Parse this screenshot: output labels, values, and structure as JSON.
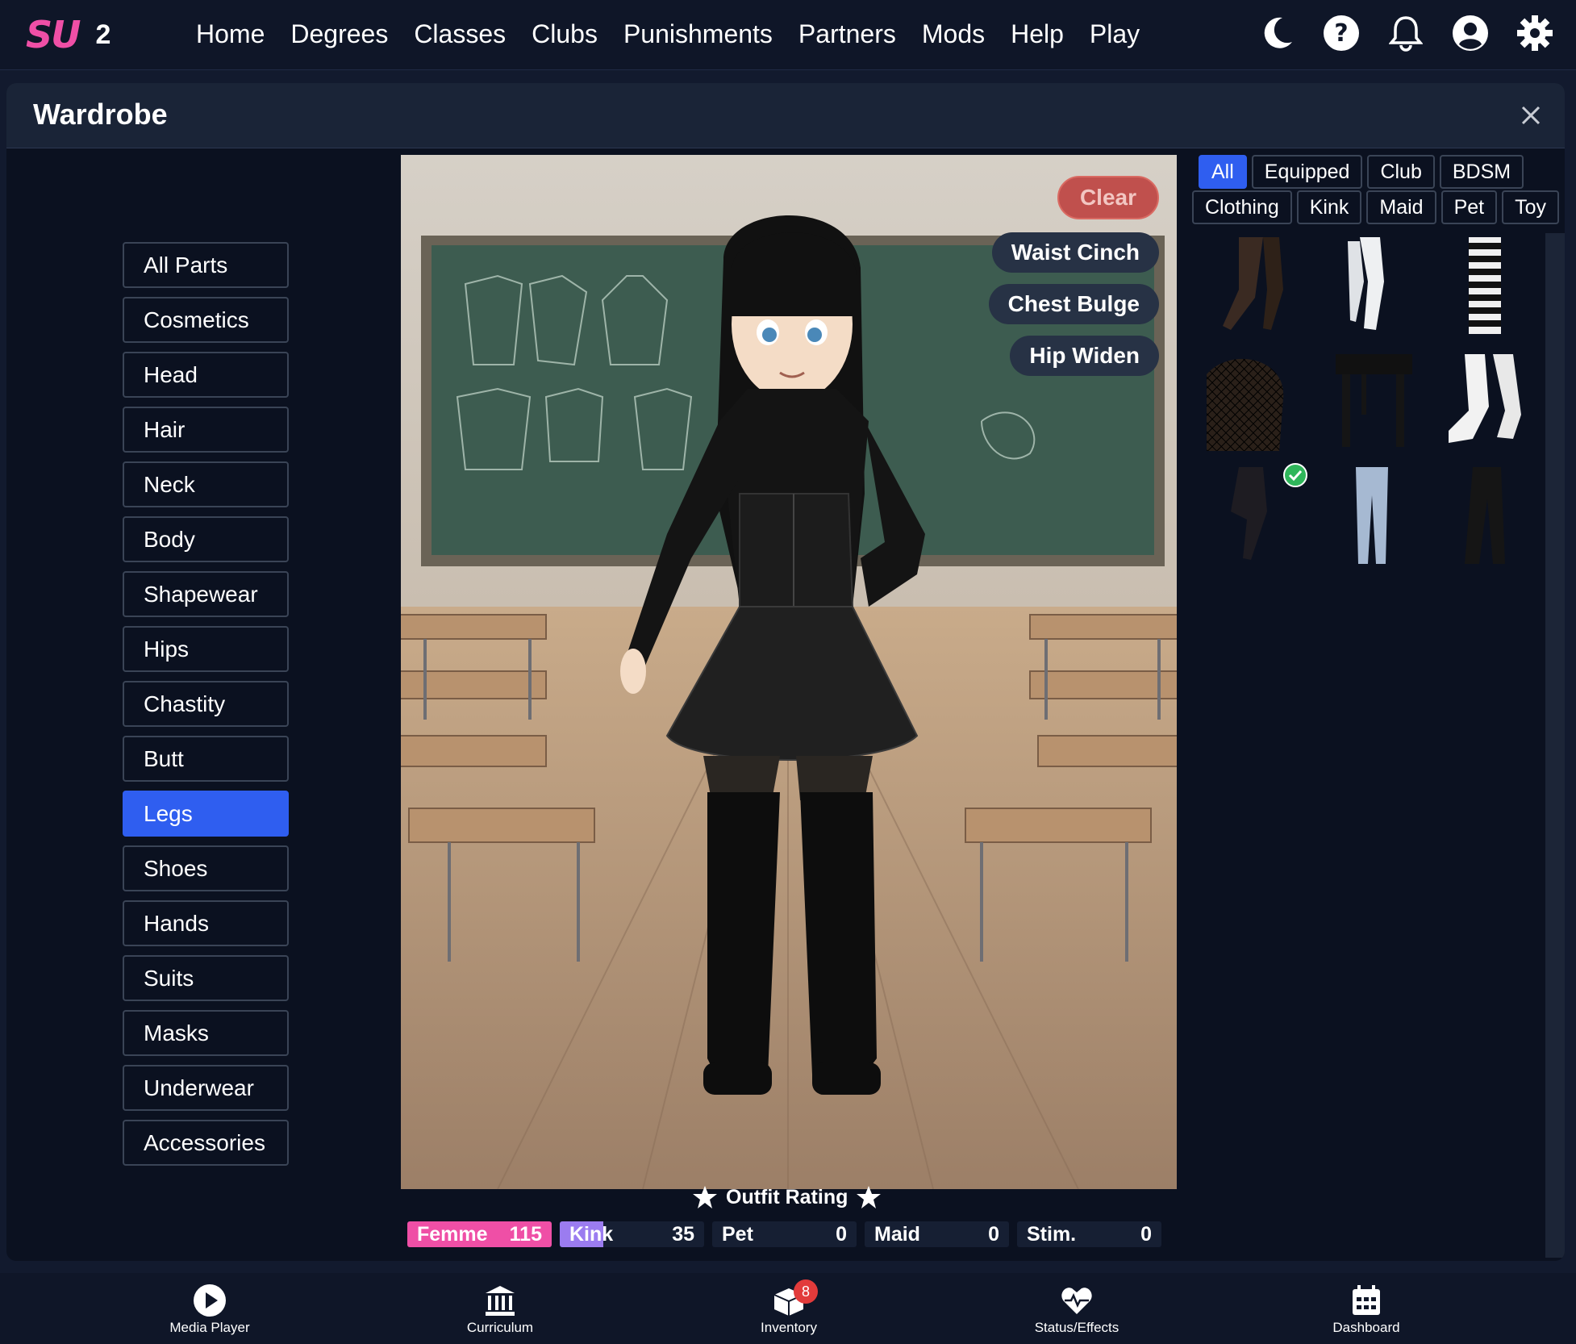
{
  "nav": {
    "logo": "SU",
    "version": "2",
    "links": [
      "Home",
      "Degrees",
      "Classes",
      "Clubs",
      "Punishments",
      "Partners",
      "Mods",
      "Help",
      "Play"
    ],
    "icons": [
      "moon-icon",
      "help-icon",
      "bell-icon",
      "user-icon",
      "gear-icon"
    ]
  },
  "wardrobe": {
    "title": "Wardrobe",
    "categories": [
      "All Parts",
      "Cosmetics",
      "Head",
      "Hair",
      "Neck",
      "Body",
      "Shapewear",
      "Hips",
      "Chastity",
      "Butt",
      "Legs",
      "Shoes",
      "Hands",
      "Suits",
      "Masks",
      "Underwear",
      "Accessories"
    ],
    "active_category": "Legs",
    "scene_buttons": {
      "clear": "Clear",
      "waist": "Waist Cinch",
      "chest": "Chest Bulge",
      "hip": "Hip Widen"
    },
    "filters_row1": [
      "All",
      "Equipped",
      "Club",
      "BDSM"
    ],
    "filters_row2": [
      "Clothing",
      "Kink",
      "Maid",
      "Pet",
      "Toy"
    ],
    "active_filter": "All",
    "items": [
      {
        "name": "sheer-thigh-high-stockings",
        "equipped": false
      },
      {
        "name": "white-thigh-high-stockings",
        "equipped": false
      },
      {
        "name": "striped-thigh-high-socks",
        "equipped": false
      },
      {
        "name": "fishnet-stockings",
        "equipped": false
      },
      {
        "name": "garter-belt",
        "equipped": false
      },
      {
        "name": "white-frilly-socks",
        "equipped": false
      },
      {
        "name": "black-pantyhose",
        "equipped": true
      },
      {
        "name": "blue-jeans",
        "equipped": false
      },
      {
        "name": "black-pants",
        "equipped": false
      }
    ],
    "rating": {
      "title": "Outfit Rating",
      "stats": [
        {
          "label": "Femme",
          "value": "115",
          "fill": 1.0,
          "color": "#ef4fa6"
        },
        {
          "label": "Kink",
          "value": "35",
          "fill": 0.3,
          "color": "#9b7cf0"
        },
        {
          "label": "Pet",
          "value": "0",
          "fill": 0,
          "color": "#161f33"
        },
        {
          "label": "Maid",
          "value": "0",
          "fill": 0,
          "color": "#161f33"
        },
        {
          "label": "Stim.",
          "value": "0",
          "fill": 0,
          "color": "#161f33"
        }
      ]
    }
  },
  "bottom": {
    "media": "Media Player",
    "curriculum": "Curriculum",
    "inventory": "Inventory",
    "inventory_badge": "8",
    "status": "Status/Effects",
    "dashboard": "Dashboard"
  },
  "colors": {
    "accent": "#2f5ef0",
    "brand": "#ef4fa6",
    "clear": "#c0504d",
    "equipped": "#2fb65a"
  }
}
